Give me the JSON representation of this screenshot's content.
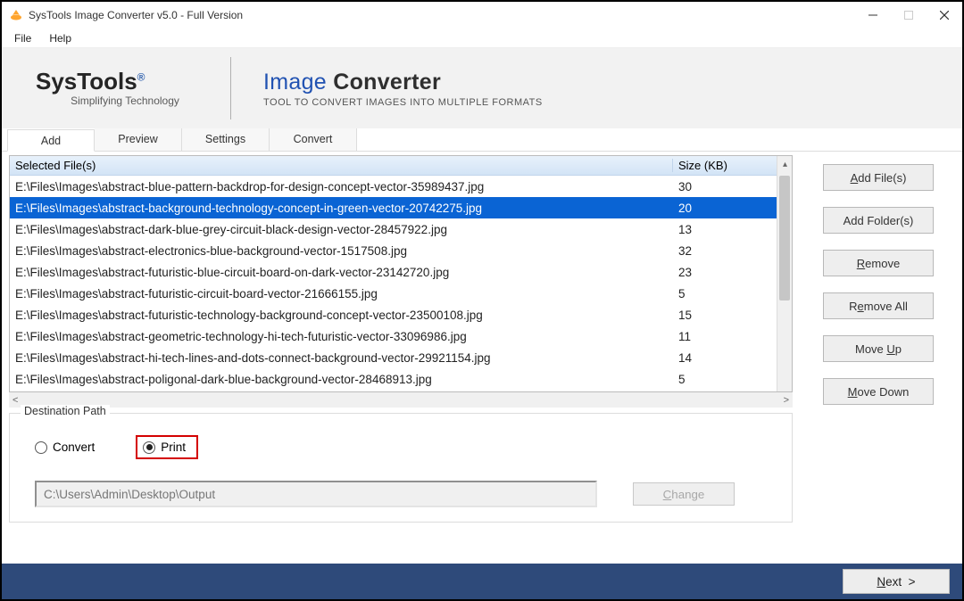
{
  "window": {
    "title": "SysTools Image Converter v5.0 - Full Version"
  },
  "menu": {
    "file": "File",
    "help": "Help"
  },
  "banner": {
    "brand": "SysTools",
    "reg": "®",
    "tagline": "Simplifying Technology",
    "product_a": "Image",
    "product_b": "Converter",
    "sub": "TOOL TO CONVERT IMAGES INTO MULTIPLE FORMATS"
  },
  "tabs": {
    "add": "Add",
    "preview": "Preview",
    "settings": "Settings",
    "convert": "Convert"
  },
  "list": {
    "header_file": "Selected File(s)",
    "header_size": "Size (KB)",
    "rows": [
      {
        "file": "E:\\Files\\Images\\abstract-blue-pattern-backdrop-for-design-concept-vector-35989437.jpg",
        "size": "30",
        "selected": false
      },
      {
        "file": "E:\\Files\\Images\\abstract-background-technology-concept-in-green-vector-20742275.jpg",
        "size": "20",
        "selected": true
      },
      {
        "file": "E:\\Files\\Images\\abstract-dark-blue-grey-circuit-black-design-vector-28457922.jpg",
        "size": "13",
        "selected": false
      },
      {
        "file": "E:\\Files\\Images\\abstract-electronics-blue-background-vector-1517508.jpg",
        "size": "32",
        "selected": false
      },
      {
        "file": "E:\\Files\\Images\\abstract-futuristic-blue-circuit-board-on-dark-vector-23142720.jpg",
        "size": "23",
        "selected": false
      },
      {
        "file": "E:\\Files\\Images\\abstract-futuristic-circuit-board-vector-21666155.jpg",
        "size": "5",
        "selected": false
      },
      {
        "file": "E:\\Files\\Images\\abstract-futuristic-technology-background-concept-vector-23500108.jpg",
        "size": "15",
        "selected": false
      },
      {
        "file": "E:\\Files\\Images\\abstract-geometric-technology-hi-tech-futuristic-vector-33096986.jpg",
        "size": "11",
        "selected": false
      },
      {
        "file": "E:\\Files\\Images\\abstract-hi-tech-lines-and-dots-connect-background-vector-29921154.jpg",
        "size": "14",
        "selected": false
      },
      {
        "file": "E:\\Files\\Images\\abstract-poligonal-dark-blue-background-vector-28468913.jpg",
        "size": "5",
        "selected": false
      }
    ]
  },
  "side": {
    "add_files": "Add File(s)",
    "add_folders": "Add Folder(s)",
    "remove": "Remove",
    "remove_all": "Remove All",
    "move_up": "Move Up",
    "move_down": "Move Down"
  },
  "dest": {
    "legend": "Destination Path",
    "convert": "Convert",
    "print": "Print",
    "path": "C:\\Users\\Admin\\Desktop\\Output",
    "change": "Change"
  },
  "footer": {
    "next": "Next  >"
  }
}
